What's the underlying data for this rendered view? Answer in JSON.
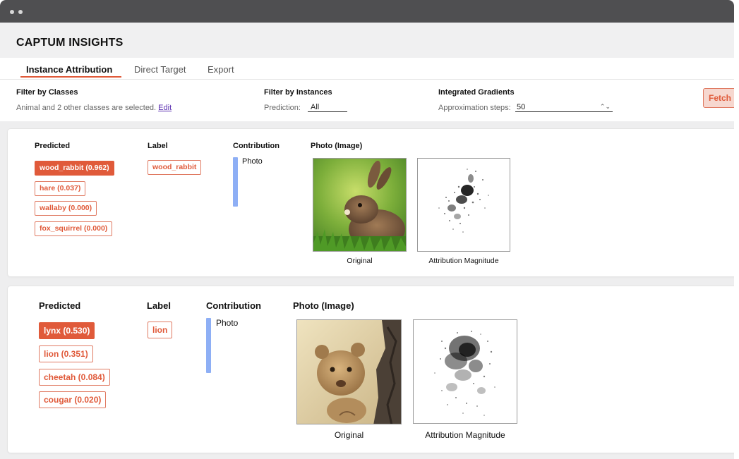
{
  "app": {
    "title": "CAPTUM INSIGHTS"
  },
  "tabs": [
    {
      "label": "Instance Attribution",
      "active": true
    },
    {
      "label": "Direct Target",
      "active": false
    },
    {
      "label": "Export",
      "active": false
    }
  ],
  "filters": {
    "classes": {
      "label": "Filter by Classes",
      "summary": "Animal and 2 other classes are selected.",
      "edit_label": "Edit"
    },
    "instances": {
      "label": "Filter by Instances",
      "prediction_label": "Prediction:",
      "prediction_value": "All"
    },
    "method": {
      "label": "Integrated Gradients",
      "steps_label": "Approximation steps:",
      "steps_value": "50"
    },
    "fetch_label": "Fetch"
  },
  "columns": {
    "predicted": "Predicted",
    "label": "Label",
    "contribution": "Contribution",
    "photo": "Photo (Image)"
  },
  "instances": [
    {
      "predictions": [
        {
          "text": "wood_rabbit (0.962)",
          "top": true
        },
        {
          "text": "hare (0.037)",
          "top": false
        },
        {
          "text": "wallaby (0.000)",
          "top": false
        },
        {
          "text": "fox_squirrel (0.000)",
          "top": false
        }
      ],
      "label": "wood_rabbit",
      "contribution": {
        "feature": "Photo",
        "value": 1.0
      },
      "captions": {
        "original": "Original",
        "attribution": "Attribution Magnitude"
      }
    },
    {
      "predictions": [
        {
          "text": "lynx (0.530)",
          "top": true
        },
        {
          "text": "lion (0.351)",
          "top": false
        },
        {
          "text": "cheetah (0.084)",
          "top": false
        },
        {
          "text": "cougar (0.020)",
          "top": false
        }
      ],
      "label": "lion",
      "contribution": {
        "feature": "Photo",
        "value": 1.0
      },
      "captions": {
        "original": "Original",
        "attribution": "Attribution Magnitude"
      }
    }
  ],
  "colors": {
    "accent": "#e05a3a",
    "contribution_bar": "#8eaff5",
    "titlebar": "#4f4f51"
  }
}
